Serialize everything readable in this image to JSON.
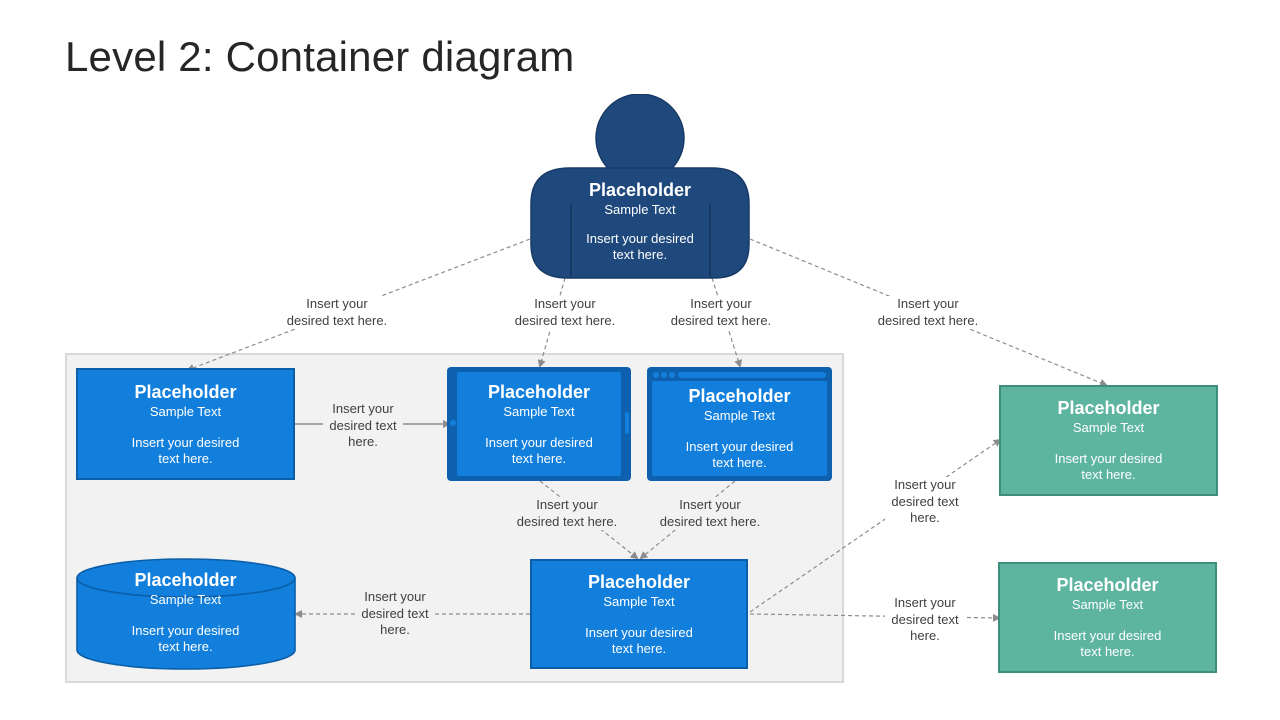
{
  "slide": {
    "title": "Level 2: Container diagram"
  },
  "colors": {
    "person": "#1f497d",
    "container_blue": "#127fdc",
    "container_frame": "#0d61ae",
    "external_green": "#5db5a0",
    "boundary_bg": "#f2f2f2",
    "connector": "#8c8c8c"
  },
  "nodes": {
    "person": {
      "title": "Placeholder",
      "subtitle": "Sample Text",
      "description": "Insert your desired text here."
    },
    "web_app": {
      "title": "Placeholder",
      "subtitle": "Sample Text",
      "description": "Insert your desired text here."
    },
    "mobile_app": {
      "title": "Placeholder",
      "subtitle": "Sample Text",
      "description": "Insert your desired text here."
    },
    "browser_app": {
      "title": "Placeholder",
      "subtitle": "Sample Text",
      "description": "Insert your desired text here."
    },
    "database": {
      "title": "Placeholder",
      "subtitle": "Sample Text",
      "description": "Insert your desired text here."
    },
    "api": {
      "title": "Placeholder",
      "subtitle": "Sample Text",
      "description": "Insert your desired text here."
    },
    "external_1": {
      "title": "Placeholder",
      "subtitle": "Sample Text",
      "description": "Insert your desired text here."
    },
    "external_2": {
      "title": "Placeholder",
      "subtitle": "Sample Text",
      "description": "Insert your desired text here."
    }
  },
  "connector_labels": {
    "person_to_web": "Insert your\ndesired text here.",
    "person_to_mobile": "Insert your\ndesired text here.",
    "person_to_browser": "Insert your\ndesired text here.",
    "person_to_external1": "Insert your\ndesired text here.",
    "web_to_mobile": "Insert your\ndesired text\nhere.",
    "mobile_to_api": "Insert your\ndesired text here.",
    "browser_to_api": "Insert your\ndesired text here.",
    "api_to_database": "Insert your\ndesired text\nhere.",
    "api_to_external1": "Insert your\ndesired text\nhere.",
    "api_to_external2": "Insert your\ndesired text\nhere."
  }
}
